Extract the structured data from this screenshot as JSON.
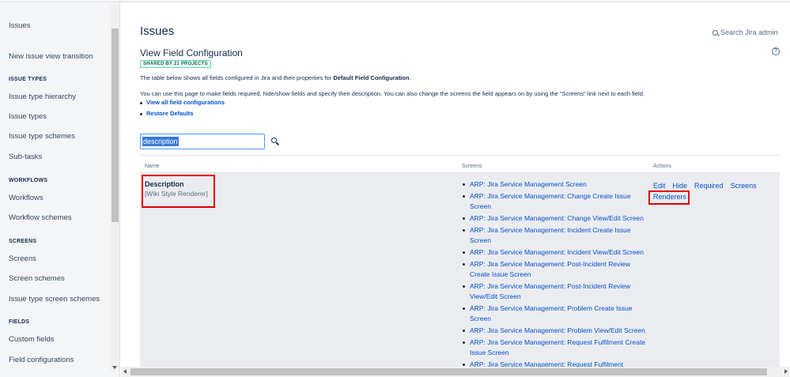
{
  "sidebar": {
    "top_item": "Issues",
    "items_before": [
      "New issue view transition"
    ],
    "sections": [
      {
        "heading": "ISSUE TYPES",
        "items": [
          "Issue type hierarchy",
          "Issue types",
          "Issue type schemes",
          "Sub-tasks"
        ]
      },
      {
        "heading": "WORKFLOWS",
        "items": [
          "Workflows",
          "Workflow schemes"
        ]
      },
      {
        "heading": "SCREENS",
        "items": [
          "Screens",
          "Screen schemes",
          "Issue type screen schemes"
        ]
      },
      {
        "heading": "FIELDS",
        "items": [
          "Custom fields",
          "Field configurations"
        ]
      }
    ]
  },
  "header": {
    "title": "Issues",
    "search_label": "Search Jira admin"
  },
  "page": {
    "subtitle": "View Field Configuration",
    "badge": "SHARED BY 21 PROJECTS",
    "desc_prefix": "The table below shows all fields configured in Jira and their properties for",
    "desc_bold": "Default Field Configuration",
    "desc_suffix": ".",
    "desc2": "You can use this page to make fields required, hide/show fields and specify their description. You can also change the screens the field appears on by using the \"Screens\" link next to each field.",
    "links": [
      "View all field configurations",
      "Restore Defaults"
    ],
    "filter_value": "description"
  },
  "table": {
    "headers": {
      "name": "Name",
      "screens": "Screens",
      "actions": "Actions"
    },
    "row": {
      "name": "Description",
      "renderer": "[Wiki Style Renderer]",
      "screens": [
        "ARP: Jira Service Management Screen",
        "ARP: Jira Service Management: Change Create Issue Screen",
        "ARP: Jira Service Management: Change View/Edit Screen",
        "ARP: Jira Service Management: Incident Create Issue Screen",
        "ARP: Jira Service Management: Incident View/Edit Screen",
        "ARP: Jira Service Management: Post-Incident Review Create Issue Screen",
        "ARP: Jira Service Management: Post-Incident Review View/Edit Screen",
        "ARP: Jira Service Management: Problem Create Issue Screen",
        "ARP: Jira Service Management: Problem View/Edit Screen",
        "ARP: Jira Service Management: Request Fulfilment Create Issue Screen",
        "ARP: Jira Service Management: Request Fulfilment"
      ],
      "actions": [
        "Edit",
        "Hide",
        "Required",
        "Screens"
      ],
      "renderers": "Renderers"
    }
  },
  "colors": {
    "link": "#0052cc",
    "text": "#172b4d",
    "highlight_box": "#e00000",
    "badge_border": "#57d9a3"
  }
}
